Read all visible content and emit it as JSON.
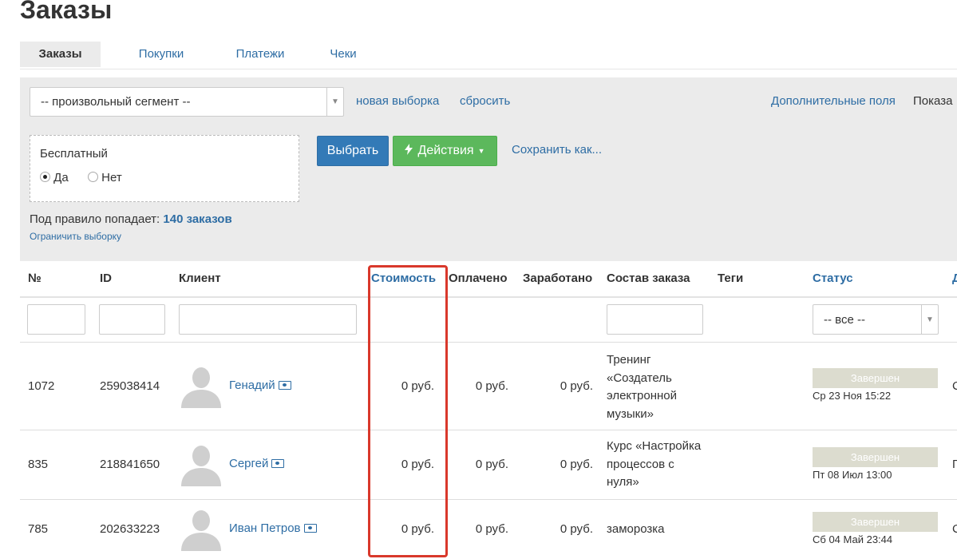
{
  "page": {
    "title": "Заказы"
  },
  "tabs": [
    {
      "label": "Заказы",
      "active": true
    },
    {
      "label": "Покупки",
      "active": false
    },
    {
      "label": "Платежи",
      "active": false
    },
    {
      "label": "Чеки",
      "active": false
    }
  ],
  "filters": {
    "segment_select": "-- произвольный сегмент --",
    "new_selection": "новая выборка",
    "reset": "сбросить",
    "extra_fields": "Дополнительные поля",
    "show_truncated": "Показа",
    "condition": {
      "title": "Бесплатный",
      "options": [
        {
          "label": "Да",
          "selected": true
        },
        {
          "label": "Нет",
          "selected": false
        }
      ]
    },
    "select_button": "Выбрать",
    "actions_button": "Действия",
    "save_as": "Сохранить как...",
    "rule_prefix": "Под правило попадает:",
    "rule_count": "140 заказов",
    "limit_link": "Ограничить выборку"
  },
  "table": {
    "headers": {
      "num": "№",
      "id": "ID",
      "client": "Клиент",
      "cost": "Стоимость",
      "paid": "Оплачено",
      "earned": "Заработано",
      "content": "Состав заказа",
      "tags": "Теги",
      "status": "Статус",
      "next": "Д"
    },
    "status_filter": "-- все --",
    "rows": [
      {
        "num": "1072",
        "id": "259038414",
        "client": "Генадий",
        "cost": "0 руб.",
        "paid": "0 руб.",
        "earned": "0 руб.",
        "content_lines": [
          "Тренинг",
          "«Создатель",
          "электронной",
          "музыки»"
        ],
        "status": "Завершен",
        "date": "Ср 23 Ноя 15:22",
        "extra": "С"
      },
      {
        "num": "835",
        "id": "218841650",
        "client": "Сергей",
        "cost": "0 руб.",
        "paid": "0 руб.",
        "earned": "0 руб.",
        "content_lines": [
          "Курс «Настройка",
          "процессов с",
          "нуля»"
        ],
        "status": "Завершен",
        "date": "Пт 08 Июл 13:00",
        "extra": "П"
      },
      {
        "num": "785",
        "id": "202633223",
        "client": "Иван Петров",
        "cost": "0 руб.",
        "paid": "0 руб.",
        "earned": "0 руб.",
        "content_lines": [
          "заморозка"
        ],
        "status": "Завершен",
        "date": "Сб 04 Май 23:44",
        "extra": "С"
      }
    ]
  },
  "colors": {
    "link": "#2e6da4",
    "primary_button": "#337ab7",
    "success_button": "#5cb85c",
    "status_badge": "#dcdccf",
    "highlight": "#d9382b"
  }
}
